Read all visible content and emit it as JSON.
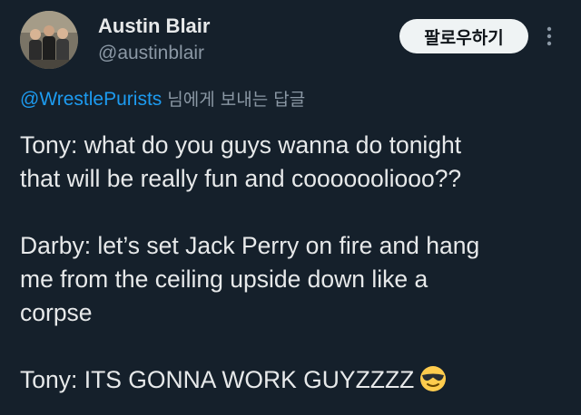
{
  "header": {
    "display_name": "Austin Blair",
    "handle": "@austinblair",
    "follow_label": "팔로우하기"
  },
  "reply": {
    "mention": "@WrestlePurists",
    "suffix": "님에게 보내는 답글"
  },
  "tweet": {
    "lines": [
      "Tony: what do you guys wanna do tonight",
      "that will be really fun and cooooooliooo??",
      "",
      "Darby: let’s set Jack Perry on fire and hang",
      "me from the ceiling upside down like a",
      "corpse",
      "",
      "Tony: ITS GONNA WORK GUYZZZZ"
    ],
    "emoji": "sunglasses-face-icon"
  },
  "colors": {
    "background": "#15202b",
    "text_primary": "#e7e9ea",
    "text_secondary": "#8b98a5",
    "link": "#1d9bf0",
    "follow_button_bg": "#eff3f4"
  }
}
